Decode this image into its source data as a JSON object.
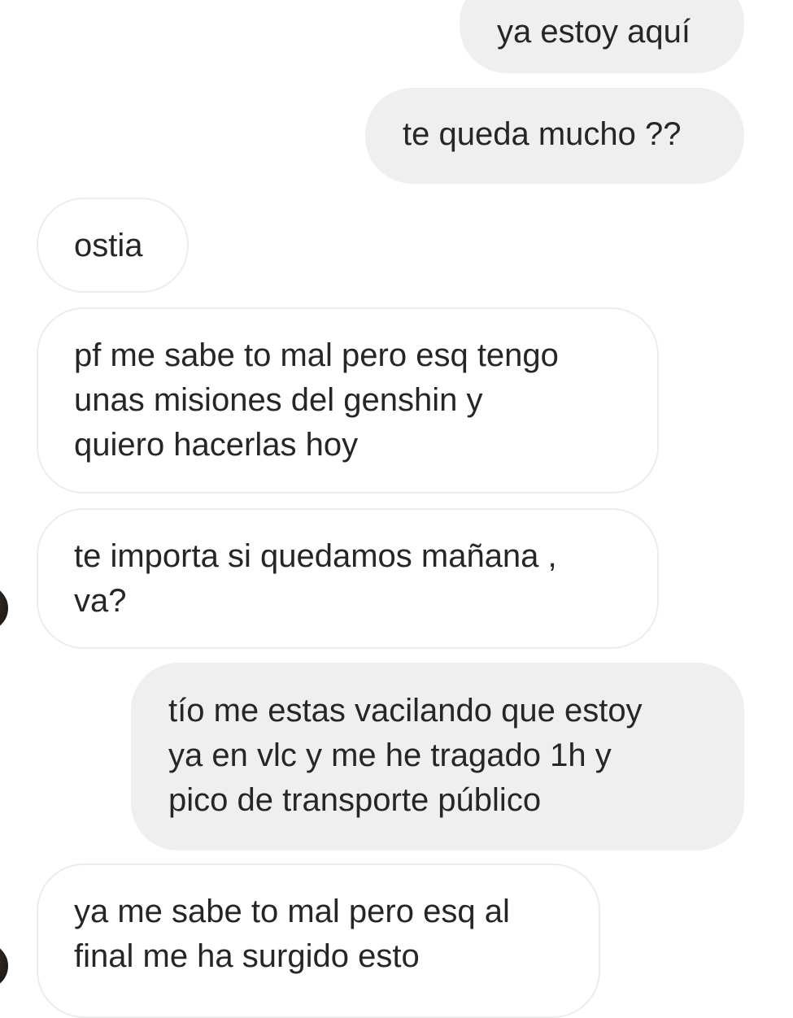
{
  "messages": [
    {
      "side": "outgoing",
      "lines": [
        "ya estoy aquí"
      ]
    },
    {
      "side": "outgoing",
      "lines": [
        "te queda mucho ??"
      ]
    },
    {
      "side": "incoming",
      "lines": [
        "ostia"
      ]
    },
    {
      "side": "incoming",
      "lines": [
        "pf me sabe to mal pero esq tengo",
        "unas misiones del genshin y",
        "quiero hacerlas hoy"
      ]
    },
    {
      "side": "incoming",
      "lines": [
        "te importa si quedamos mañana ,",
        "va?"
      ]
    },
    {
      "side": "outgoing",
      "lines": [
        "tío me estas vacilando que estoy",
        "ya en vlc y me he tragado 1h y",
        "pico de transporte público"
      ]
    },
    {
      "side": "incoming",
      "lines": [
        "ya me sabe to mal pero esq al",
        "final me ha surgido esto"
      ]
    }
  ],
  "colors": {
    "outgoing_bubble": "#efefef",
    "incoming_bubble": "#ffffff",
    "incoming_border": "#ececec",
    "text": "#262626"
  }
}
